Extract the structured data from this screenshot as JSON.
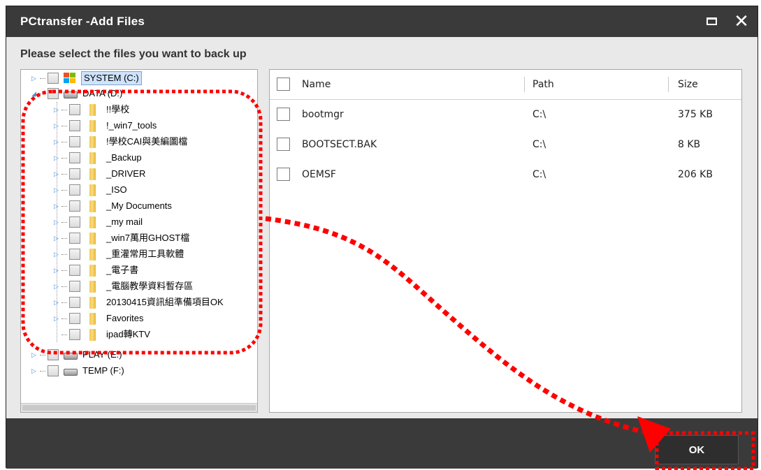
{
  "window": {
    "title": "PCtransfer -Add Files"
  },
  "prompt": "Please select the files you want to back up",
  "tree": {
    "drives": [
      {
        "label": "SYSTEM (C:)"
      },
      {
        "label": "DATA (D:)"
      },
      {
        "label": "PLAY (E:)"
      },
      {
        "label": "TEMP (F:)"
      }
    ],
    "folders": [
      "!!學校",
      "!_win7_tools",
      "!學校CAI與美編圖檔",
      "_Backup",
      "_DRIVER",
      "_ISO",
      "_My Documents",
      "_my mail",
      "_win7萬用GHOST檔",
      "_重灌常用工具軟體",
      "_電子書",
      "_電腦教學資料暫存區",
      "20130415資訊組準備項目OK",
      "Favorites",
      "ipad轉KTV"
    ]
  },
  "files": {
    "columns": {
      "name": "Name",
      "path": "Path",
      "size": "Size"
    },
    "rows": [
      {
        "name": "bootmgr",
        "path": "C:\\",
        "size": "375 KB"
      },
      {
        "name": "BOOTSECT.BAK",
        "path": "C:\\",
        "size": "8 KB"
      },
      {
        "name": "OEMSF",
        "path": "C:\\",
        "size": "206 KB"
      }
    ]
  },
  "buttons": {
    "ok": "OK",
    "close_glyph": "✕"
  },
  "colors": {
    "titlebar": "#3a3a3a",
    "annotation": "#ff0000",
    "tree_arrow": "#4a90d9"
  }
}
